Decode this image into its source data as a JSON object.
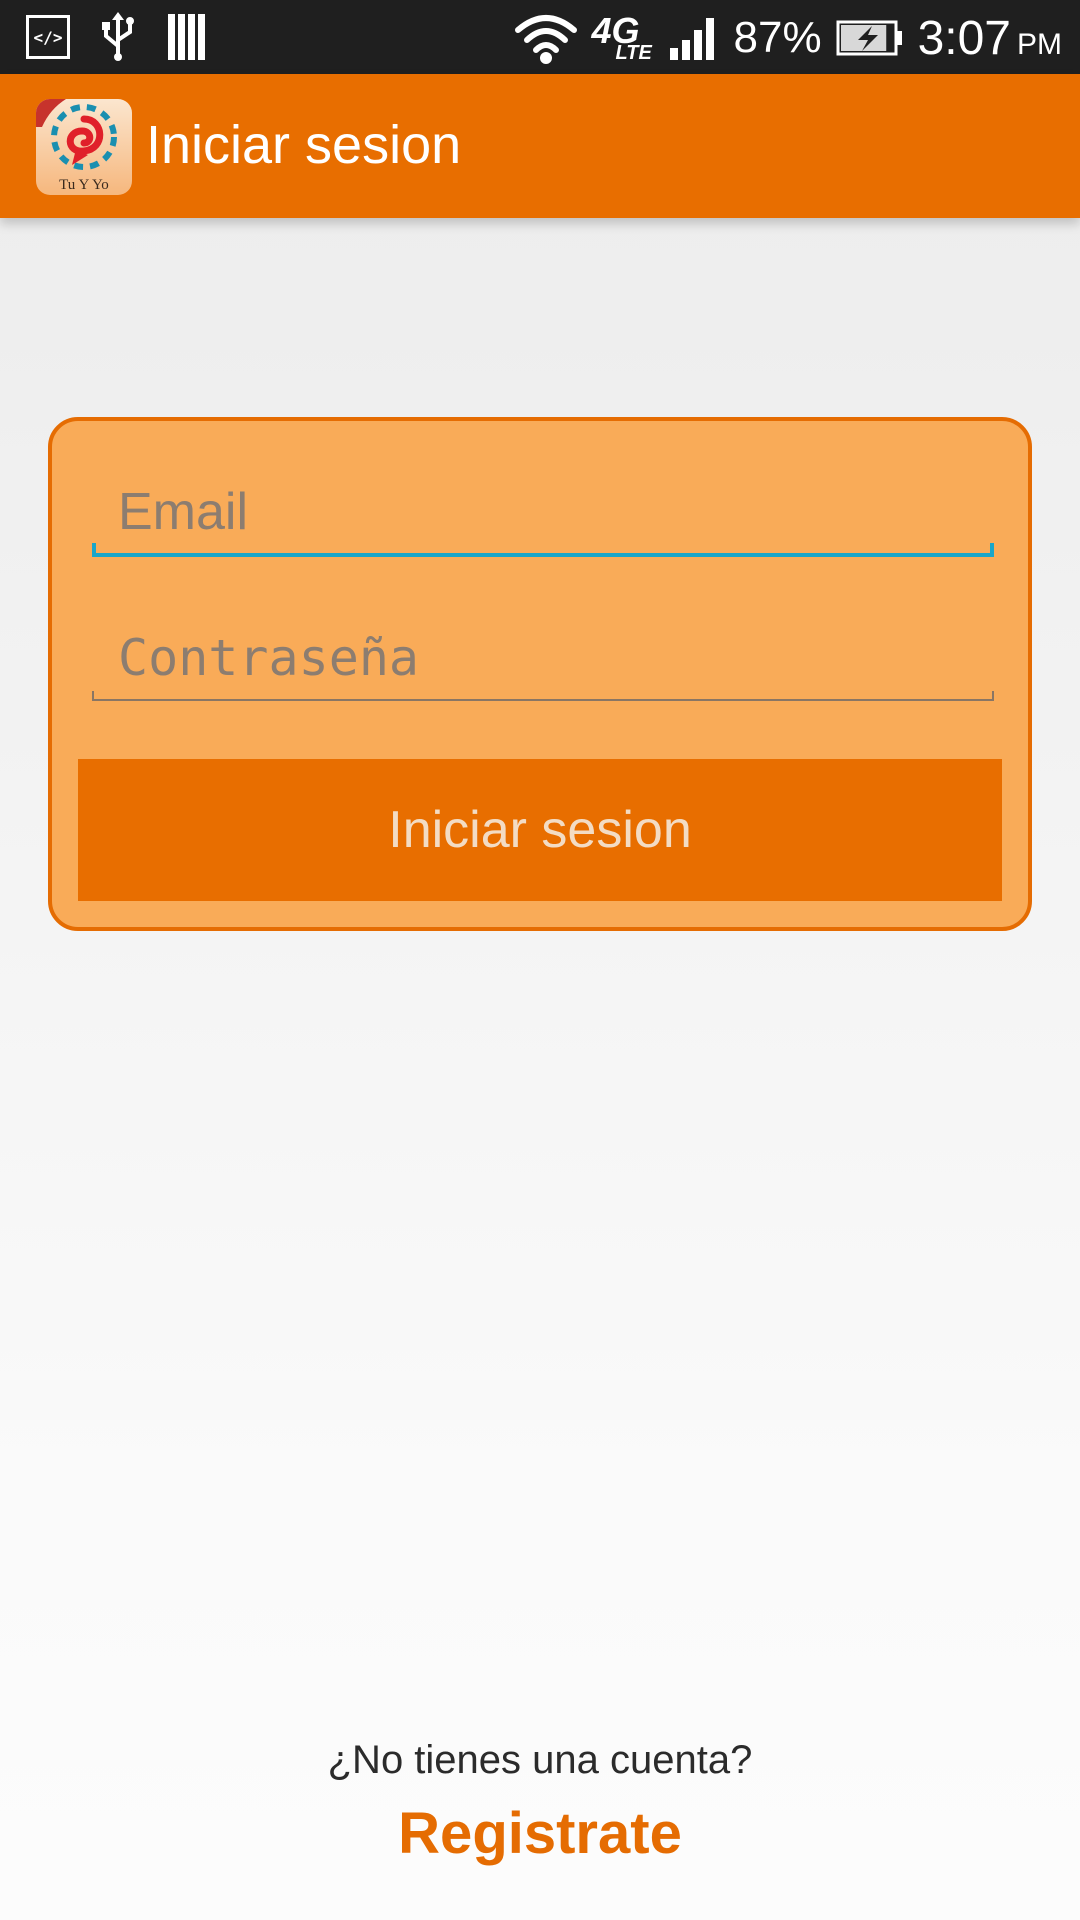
{
  "status_bar": {
    "icons_left": [
      "developer-mode-icon",
      "usb-icon",
      "storage-bars-icon"
    ],
    "icons_right": [
      "wifi-icon",
      "4g-lte-icon",
      "signal-bars-icon",
      "battery-charging-icon"
    ],
    "network_label_top": "4G",
    "network_label_bottom": "LTE",
    "battery_percent": "87%",
    "battery_level": 0.87,
    "time": "3:07",
    "ampm": "PM"
  },
  "app_bar": {
    "title": "Iniciar sesion",
    "logo_text": "Tu Y Yo",
    "background_color": "#e86e00"
  },
  "login_form": {
    "email_placeholder": "Email",
    "email_value": "",
    "password_placeholder": "Contraseña",
    "password_value": "",
    "submit_label": "Iniciar sesion",
    "accent_color": "#e86e00",
    "card_color": "#f9ab58",
    "focus_color": "#1aa6c8"
  },
  "footer": {
    "prompt": "¿No tienes una cuenta?",
    "register_label": "Registrate"
  }
}
